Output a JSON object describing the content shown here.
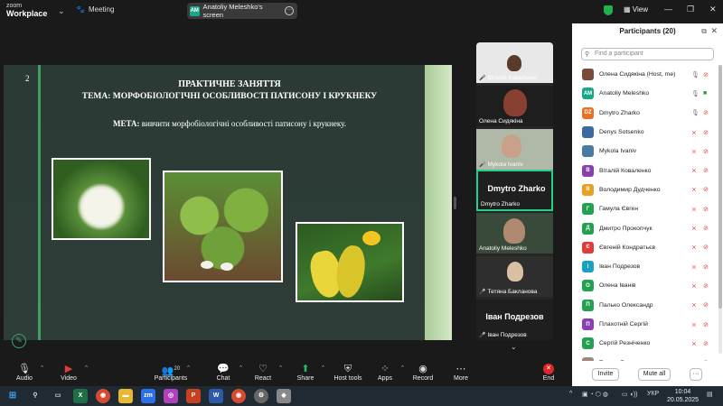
{
  "app": {
    "logo_line1": "zoom",
    "logo_line2": "Workplace",
    "meeting_label": "Meeting",
    "share_avatar": "AM",
    "share_label": "Anatoliy Meleshko's screen",
    "view_label": "View"
  },
  "slide": {
    "page_number": "2",
    "title_line1": "ПРАКТИЧНЕ ЗАНЯТТЯ",
    "title_line2": "ТЕМА: МОРФОБІОЛОГІЧНІ ОСОБЛИВОСТІ ПАТИСОНУ І КРУКНЕКУ",
    "meta_label": "МЕТА:",
    "meta_text": " вивчити морфобіологічні особливості патисону і крукнеку."
  },
  "video_strip": {
    "tiles": [
      {
        "name": "Віталій Коваленко",
        "muted": true
      },
      {
        "name": "Олена Сидякіна",
        "muted": false
      },
      {
        "name": "Mykola Ivaniv",
        "muted": true
      },
      {
        "name": "Dmytro Zharko",
        "muted": false,
        "big_label": "Dmytro Zharko"
      },
      {
        "name": "Anatoliy Meleshko",
        "muted": false
      },
      {
        "name": "Тетяна Бакланова",
        "muted": true
      },
      {
        "name": "Іван Подрезов",
        "muted": true,
        "big_label": "Іван Подрезов"
      }
    ]
  },
  "participants": {
    "title": "Participants (20)",
    "search_placeholder": "Find a participant",
    "list": [
      {
        "initials": "",
        "name": "Олена Сидякіна (Host, me)",
        "color": "#7a4a3a",
        "mic_on": true,
        "cam_on": false
      },
      {
        "initials": "AM",
        "name": "Anatoliy Meleshko",
        "color": "#19a689",
        "mic_on": true,
        "cam_on": true
      },
      {
        "initials": "DZ",
        "name": "Dmytro Zharko",
        "color": "#e8702a",
        "mic_on": true,
        "cam_on": false
      },
      {
        "initials": "",
        "name": "Denys Sotsenko",
        "color": "#3a6aa0",
        "mic_on": false,
        "cam_on": false
      },
      {
        "initials": "",
        "name": "Mykola Ivaniv",
        "color": "#4a7aa0",
        "mic_on": false,
        "cam_on": false
      },
      {
        "initials": "В",
        "name": "Віталій Коваленко",
        "color": "#8a3fb0",
        "mic_on": false,
        "cam_on": false
      },
      {
        "initials": "В",
        "name": "Володимир Дудченко",
        "color": "#e8a020",
        "mic_on": false,
        "cam_on": false
      },
      {
        "initials": "Г",
        "name": "Гамула Євген",
        "color": "#23a050",
        "mic_on": false,
        "cam_on": false
      },
      {
        "initials": "Д",
        "name": "Дмитро Прокопчук",
        "color": "#23a050",
        "mic_on": false,
        "cam_on": false
      },
      {
        "initials": "Є",
        "name": "Євгеній Кондратьєв",
        "color": "#e03b3b",
        "mic_on": false,
        "cam_on": false
      },
      {
        "initials": "І",
        "name": "Іван Подрезов",
        "color": "#1aa0c0",
        "mic_on": false,
        "cam_on": false
      },
      {
        "initials": "О",
        "name": "Олена Іванів",
        "color": "#23a050",
        "mic_on": false,
        "cam_on": false
      },
      {
        "initials": "П",
        "name": "Палько Олександр",
        "color": "#23a050",
        "mic_on": false,
        "cam_on": false
      },
      {
        "initials": "П",
        "name": "Плахотній Сергій",
        "color": "#8a3fb0",
        "mic_on": false,
        "cam_on": false
      },
      {
        "initials": "С",
        "name": "Сергій Резніченко",
        "color": "#23a050",
        "mic_on": false,
        "cam_on": false
      },
      {
        "initials": "",
        "name": "Тетяна Бакланова",
        "color": "#9a8a7a",
        "mic_on": false,
        "cam_on": false
      }
    ],
    "invite_label": "Invite",
    "mute_all_label": "Mute all",
    "more_label": "···"
  },
  "toolbar": {
    "audio": "Audio",
    "video": "Video",
    "participants": "Participants",
    "participants_count": "20",
    "chat": "Chat",
    "react": "React",
    "share": "Share",
    "host_tools": "Host tools",
    "apps": "Apps",
    "record": "Record",
    "more": "More",
    "end": "End"
  },
  "taskbar": {
    "language": "УКР",
    "time": "10:04",
    "date": "20.05.2025"
  }
}
